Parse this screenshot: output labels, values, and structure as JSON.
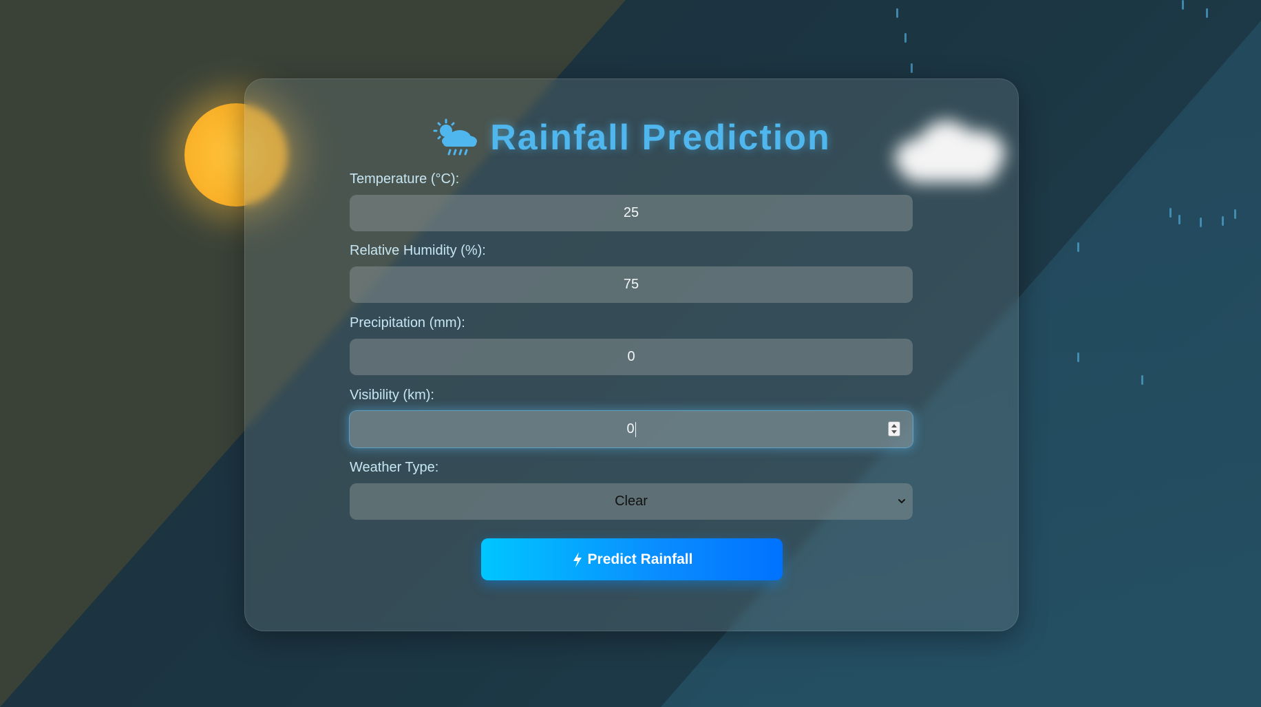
{
  "page": {
    "title": "Rainfall Prediction",
    "title_icon": "sun-behind-rain-cloud-icon"
  },
  "form": {
    "fields": [
      {
        "label": "Temperature (°C):",
        "value": "25",
        "type": "number"
      },
      {
        "label": "Relative Humidity (%):",
        "value": "75",
        "type": "number"
      },
      {
        "label": "Precipitation (mm):",
        "value": "0",
        "type": "number"
      },
      {
        "label": "Visibility (km):",
        "value": "0",
        "type": "number",
        "focused": true
      }
    ],
    "weather_type": {
      "label": "Weather Type:",
      "selected": "Clear"
    },
    "submit": {
      "label": "Predict Rainfall",
      "icon": "lightning-bolt-icon"
    }
  },
  "colors": {
    "accent": "#4fb7ee",
    "button_start": "#00c6ff",
    "button_end": "#0072ff",
    "label": "#c7e6f3",
    "sun": "#fbb42b"
  },
  "decorations": {
    "sun": "sun-icon",
    "cloud": "cloud-icon",
    "rain": "raindrop-icon"
  }
}
